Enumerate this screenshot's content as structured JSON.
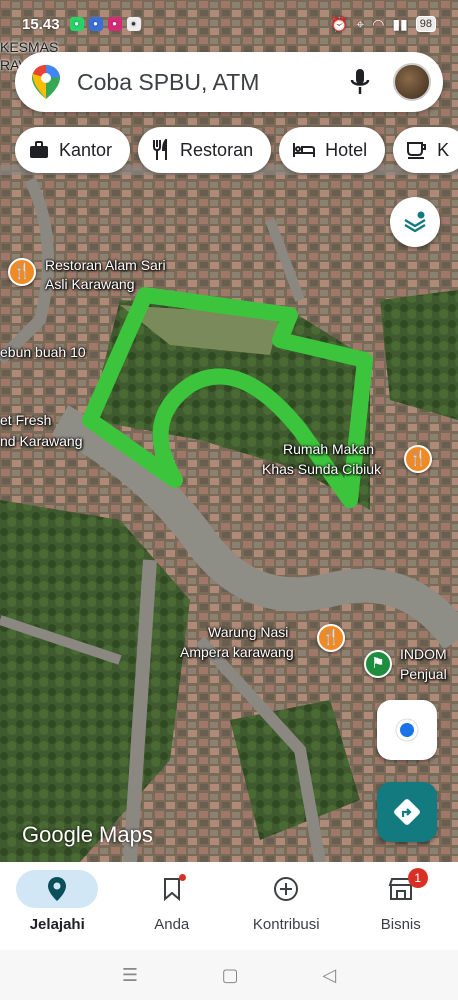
{
  "status_bar": {
    "time": "15.43",
    "battery": "98"
  },
  "search": {
    "placeholder": "Coba SPBU, ATM"
  },
  "chips": [
    {
      "label": "Kantor",
      "icon": "briefcase-icon"
    },
    {
      "label": "Restoran",
      "icon": "restaurant-icon"
    },
    {
      "label": "Hotel",
      "icon": "hotel-icon"
    },
    {
      "label": "K",
      "icon": "coffee-icon"
    }
  ],
  "map": {
    "labels": {
      "top_left": "KESMAS",
      "top_left_2": "RAV",
      "restoran_line1": "Restoran Alam Sari",
      "restoran_line2": "Asli Karawang",
      "kebun": "ebun buah 10",
      "fresh_line1": "et Fresh",
      "fresh_line2": "nd Karawang",
      "rumah_line1": "Rumah Makan",
      "rumah_line2": "Khas Sunda Cibiuk",
      "warung_line1": "Warung Nasi",
      "warung_line2": "Ampera karawang",
      "indomaret_line1": "INDOM",
      "indomaret_line2": "Penjual"
    },
    "attribution": "Google Maps"
  },
  "bottom_nav": [
    {
      "label": "Jelajahi",
      "icon": "explore-pin-icon",
      "active": true
    },
    {
      "label": "Anda",
      "icon": "bookmark-icon"
    },
    {
      "label": "Kontribusi",
      "icon": "add-circle-icon"
    },
    {
      "label": "Bisnis",
      "icon": "store-icon",
      "badge": "1"
    }
  ],
  "colors": {
    "accent": "#137a7f",
    "highlight": "#3dc43d",
    "poi": "#f08a24"
  }
}
